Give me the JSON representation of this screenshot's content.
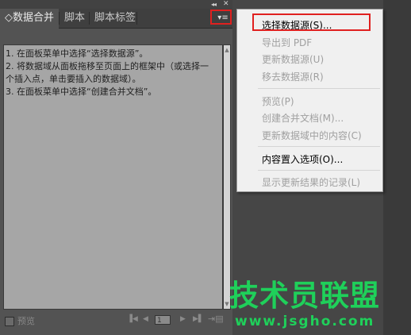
{
  "panel": {
    "tabs": [
      {
        "label": "◇数据合并"
      },
      {
        "label": "脚本"
      },
      {
        "label": "脚本标签"
      }
    ],
    "menu_button_glyph": "▾≡",
    "collapse_glyph": "◂◂",
    "close_glyph": "✕",
    "instructions": [
      "1. 在面板菜单中选择“选择数据源”。",
      "2. 将数据域从面板拖移至页面上的框架中（或选择一个插入点，单击要插入的数据域）。",
      "3. 在面板菜单中选择“创建合并文档”。"
    ],
    "footer": {
      "preview_label": "预览",
      "page_value": "1"
    }
  },
  "menu": {
    "items": [
      {
        "label": "选择数据源(S)...",
        "enabled": true
      },
      {
        "label": "导出到 PDF",
        "enabled": false
      },
      {
        "label": "更新数据源(U)",
        "enabled": false
      },
      {
        "label": "移去数据源(R)",
        "enabled": false
      },
      {
        "label": "预览(P)",
        "enabled": false
      },
      {
        "label": "创建合并文档(M)...",
        "enabled": false
      },
      {
        "label": "更新数据域中的内容(C)",
        "enabled": false
      },
      {
        "label": "内容置入选项(O)...",
        "enabled": true
      },
      {
        "label": "显示更新结果的记录(L)",
        "enabled": false
      }
    ]
  },
  "watermark": {
    "title": "技术员联盟",
    "url": "www.jsgho.com"
  },
  "colors": {
    "highlight_box": "#e0201f",
    "watermark": "#1fd05a",
    "menu_bg": "#f0f0f0"
  }
}
